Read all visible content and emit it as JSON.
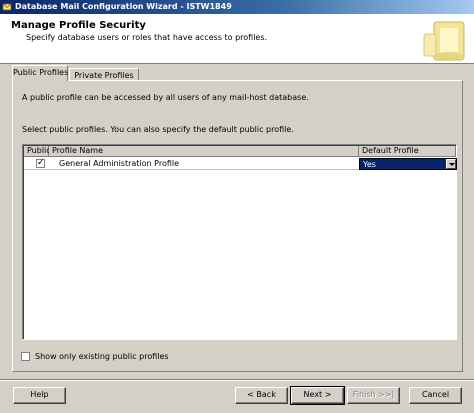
{
  "window": {
    "title": "Database Mail Configuration Wizard - ISTW1849"
  },
  "header": {
    "title": "Manage Profile Security",
    "subtitle": "Specify database users or roles that have access to profiles."
  },
  "tabs": [
    {
      "label": "Public Profiles",
      "active": true
    },
    {
      "label": "Private Profiles",
      "active": false
    }
  ],
  "panel": {
    "description": "A public profile can be accessed by all users of any mail-host database.",
    "instruction": "Select public profiles. You can also specify the default public profile."
  },
  "grid": {
    "columns": [
      "Public",
      "Profile Name",
      "Default Profile"
    ],
    "rows": [
      {
        "public": true,
        "profile_name": "General Administration Profile",
        "default_profile": "Yes"
      }
    ]
  },
  "show_existing": {
    "label": "Show only existing public profiles",
    "checked": false
  },
  "buttons": {
    "help": "Help",
    "back": "< Back",
    "next": "Next >",
    "finish": "Finish >>|",
    "cancel": "Cancel"
  },
  "icons": {
    "app": "database-mail-icon",
    "checkmark": "✓",
    "header_art": "wizard-banner-icon"
  }
}
